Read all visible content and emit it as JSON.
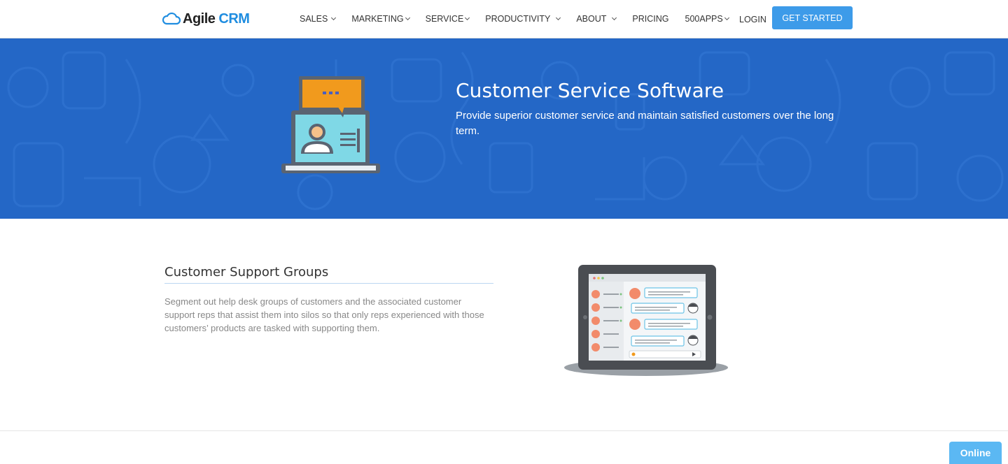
{
  "nav": {
    "logo_first": "Agile",
    "logo_second": "CRM",
    "items": [
      {
        "label": "SALES"
      },
      {
        "label": "MARKETING"
      },
      {
        "label": "SERVICE"
      },
      {
        "label": "PRODUCTIVITY"
      },
      {
        "label": "ABOUT"
      },
      {
        "label": "PRICING"
      },
      {
        "label": "500APPS"
      }
    ],
    "login": "LOGIN",
    "cta": "GET STARTED"
  },
  "hero": {
    "title": "Customer Service Software",
    "subtitle": "Provide superior customer service and maintain satisfied customers over the long term."
  },
  "feature": {
    "title": "Customer Support Groups",
    "description": "Segment out help desk groups of customers and the associated customer support reps that assist them into silos so that only reps experienced with those customers’ products are tasked with supporting them."
  },
  "chat_widget": {
    "label": "Online"
  },
  "colors": {
    "hero_bg": "#2467c6",
    "accent": "#3d9be9",
    "online_badge": "#5bb8f3"
  },
  "icons": {
    "logo": "cloud-icon",
    "hero": "support-laptop-icon",
    "feature": "chat-tablet-illustration"
  }
}
